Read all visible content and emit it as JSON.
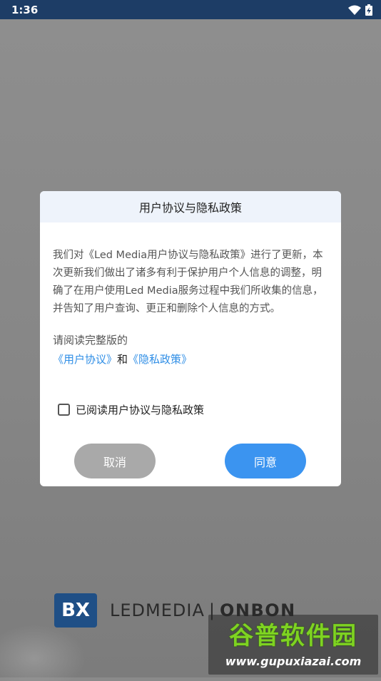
{
  "status_bar": {
    "time": "1:36",
    "icons": [
      "wifi-icon",
      "battery-charging-icon"
    ]
  },
  "dialog": {
    "title": "用户协议与隐私政策",
    "message": "我们对《Led Media用户协议与隐私政策》进行了更新，本次更新我们做出了诸多有利于保护用户个人信息的调整，明确了在用户使用Led Media服务过程中我们所收集的信息，并告知了用户查询、更正和删除个人信息的方式。",
    "prompt": "请阅读完整版的",
    "user_agreement_link": "《用户协议》",
    "and_text": "和",
    "privacy_policy_link": "《隐私政策》",
    "checkbox_label": "已阅读用户协议与隐私政策",
    "checkbox_checked": false,
    "cancel_label": "取消",
    "agree_label": "同意"
  },
  "branding": {
    "logo_text": "BX",
    "brand_left": "LEDMEDIA",
    "brand_sep": "|",
    "brand_right": "ONBON"
  },
  "watermark": {
    "title": "谷普软件园",
    "url": "www.gupuxiazai.com"
  },
  "colors": {
    "status_bar": "#1d3d66",
    "link": "#2f8ee6",
    "agree_button": "#3b94f0",
    "cancel_button": "#a9a9a9",
    "dialog_header": "#eef3fb"
  }
}
